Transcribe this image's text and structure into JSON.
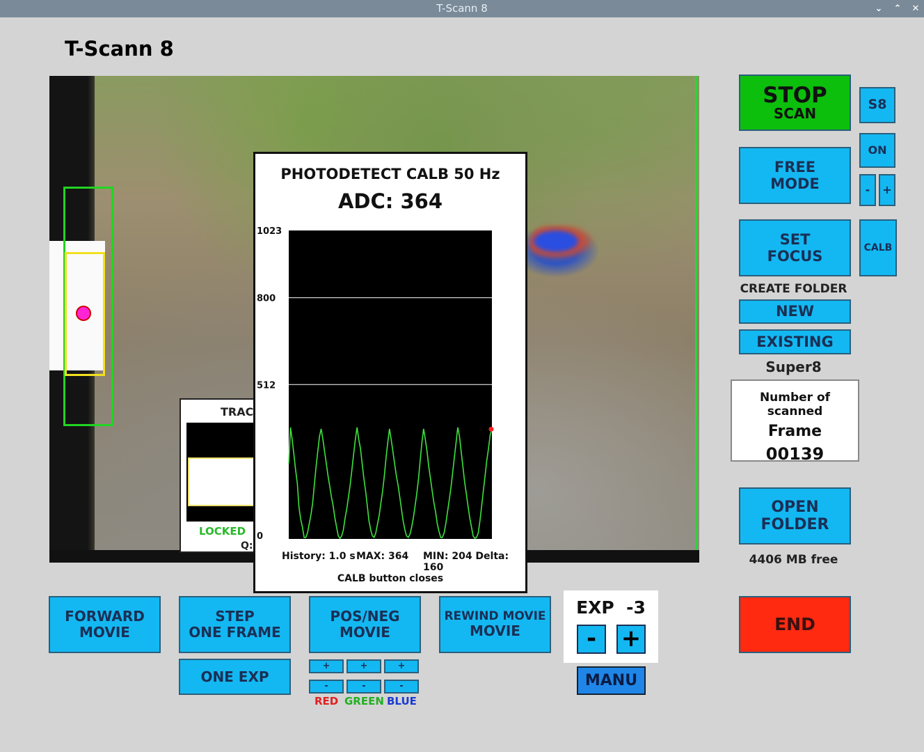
{
  "window": {
    "title": "T-Scann 8",
    "min_icon": "chevron-down-icon",
    "max_icon": "chevron-up-icon",
    "close_icon": "close-icon"
  },
  "app": {
    "title": "T-Scann 8"
  },
  "popup": {
    "title": "PHOTODETECT CALB 50 Hz",
    "adc": "ADC: 364",
    "footer": {
      "history": "History: 1.0 s",
      "max": "MAX: 364",
      "min_delta": "MIN: 204 Delta: 160"
    },
    "close_hint": "CALB button closes"
  },
  "chart_data": {
    "type": "line",
    "title": "PHOTODETECT CALB 50 Hz",
    "ylim": [
      0,
      1023
    ],
    "yticks": [
      {
        "value": 1023,
        "label": "1023"
      },
      {
        "value": 800,
        "label": "800"
      },
      {
        "value": 512,
        "label": "512"
      },
      {
        "value": 0,
        "label": "0"
      }
    ],
    "gridlines": [
      800,
      512
    ],
    "series": [
      {
        "color": "#3ee23e",
        "values": [
          250,
          370,
          330,
          280,
          230,
          185,
          105,
          65,
          40,
          5,
          5,
          20,
          50,
          80,
          120,
          180,
          240,
          290,
          340,
          365,
          330,
          290,
          250,
          210,
          175,
          140,
          110,
          70,
          40,
          10,
          2,
          10,
          30,
          70,
          100,
          140,
          180,
          230,
          280,
          330,
          370,
          330,
          300,
          250,
          200,
          160,
          110,
          60,
          30,
          10,
          5,
          20,
          50,
          80,
          120,
          160,
          210,
          270,
          320,
          365,
          330,
          290,
          250,
          210,
          180,
          140,
          100,
          60,
          30,
          10,
          5,
          15,
          40,
          70,
          110,
          150,
          200,
          260,
          320,
          365,
          330,
          290,
          240,
          200,
          160,
          120,
          90,
          50,
          25,
          5,
          5,
          20,
          50,
          90,
          130,
          170,
          220,
          270,
          320,
          370,
          340,
          290,
          240,
          190,
          150,
          110,
          70,
          40,
          10,
          2,
          5,
          20,
          60,
          110,
          160,
          210,
          260,
          300,
          345,
          364
        ]
      }
    ],
    "marker": {
      "value": 364,
      "color": "#ff2020"
    }
  },
  "tracking": {
    "title": "TRAC",
    "status": "LOCKED",
    "q_label": "Q:"
  },
  "buttons": {
    "stop_scan": [
      "STOP",
      "SCAN"
    ],
    "s8": "S8",
    "on": "ON",
    "minus": "-",
    "plus": "+",
    "free_mode": [
      "FREE",
      "MODE"
    ],
    "set_focus": [
      "SET",
      "FOCUS"
    ],
    "calb": "CALB",
    "create_folder_label": "CREATE FOLDER",
    "new": "NEW",
    "existing": "EXISTING",
    "film_type": "Super8",
    "open_folder": [
      "OPEN",
      "FOLDER"
    ],
    "free_space": "4406 MB free",
    "end": "END",
    "forward_movie": [
      "FORWARD",
      "MOVIE"
    ],
    "step_one_frame": [
      "STEP",
      "ONE FRAME"
    ],
    "pos_neg_movie": [
      "POS/NEG",
      "MOVIE"
    ],
    "rewind_movie": [
      "REWIND MOVIE",
      "MOVIE"
    ],
    "one_exp": "ONE EXP",
    "manu": "MANU"
  },
  "frame_counter": {
    "label1": "Number of scanned",
    "label2": "Frame",
    "value": "00139"
  },
  "exposure": {
    "label": "EXP  -3",
    "minus": "-",
    "plus": "+"
  },
  "color_adjust": {
    "plus": "+",
    "minus": "-",
    "red": "RED",
    "green": "GREEN",
    "blue": "BLUE",
    "colors": {
      "red": "#e02020",
      "green": "#22b022",
      "blue": "#1a3ad0"
    }
  },
  "colors": {
    "accent": "#13b8f2",
    "stop": "#0cbf0c",
    "end": "#ff2a10",
    "manu": "#1f86e8"
  }
}
